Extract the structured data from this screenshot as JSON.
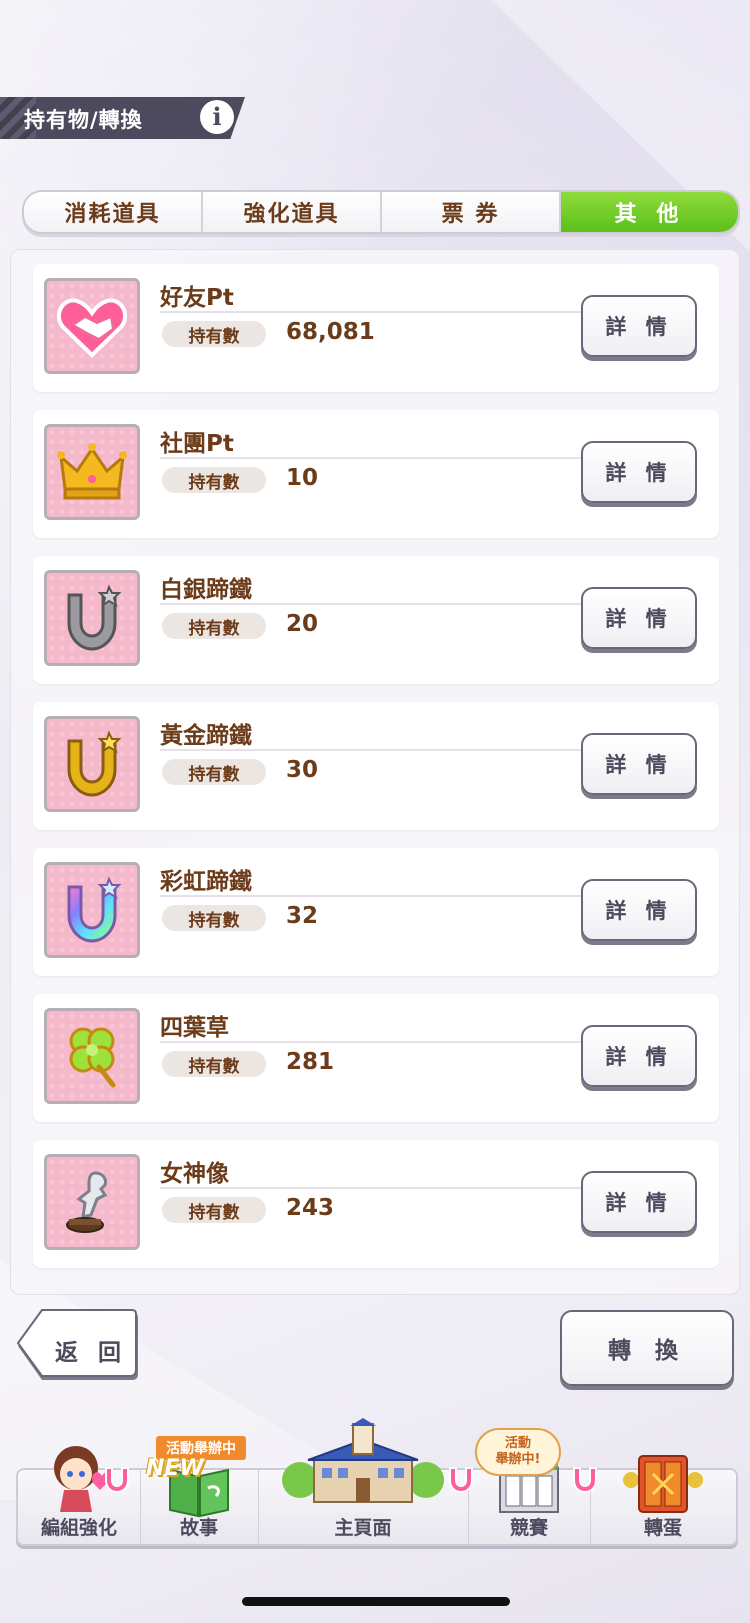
{
  "header": {
    "title": "持有物/轉換",
    "info_label": "i"
  },
  "tabs": [
    {
      "label": "消耗道具",
      "active": false
    },
    {
      "label": "強化道具",
      "active": false
    },
    {
      "label": "票 券",
      "active": false
    },
    {
      "label": "其 他",
      "active": true
    }
  ],
  "items": [
    {
      "name": "好友Pt",
      "hold_label": "持有數",
      "value": "68,081",
      "detail": "詳 情",
      "icon": "handshake-heart-icon"
    },
    {
      "name": "社團Pt",
      "hold_label": "持有數",
      "value": "10",
      "detail": "詳 情",
      "icon": "crown-icon"
    },
    {
      "name": "白銀蹄鐵",
      "hold_label": "持有數",
      "value": "20",
      "detail": "詳 情",
      "icon": "silver-horseshoe-icon"
    },
    {
      "name": "黃金蹄鐵",
      "hold_label": "持有數",
      "value": "30",
      "detail": "詳 情",
      "icon": "gold-horseshoe-icon"
    },
    {
      "name": "彩虹蹄鐵",
      "hold_label": "持有數",
      "value": "32",
      "detail": "詳 情",
      "icon": "rainbow-horseshoe-icon"
    },
    {
      "name": "四葉草",
      "hold_label": "持有數",
      "value": "281",
      "detail": "詳 情",
      "icon": "four-leaf-clover-icon"
    },
    {
      "name": "女神像",
      "hold_label": "持有數",
      "value": "243",
      "detail": "詳 情",
      "icon": "goddess-statue-icon"
    }
  ],
  "actions": {
    "back": "返 回",
    "convert": "轉 換"
  },
  "nav": {
    "items": [
      {
        "label": "編組強化",
        "icon": "character-icon"
      },
      {
        "label": "故事",
        "icon": "book-icon"
      },
      {
        "label": "主頁面",
        "icon": "school-building-icon"
      },
      {
        "label": "競賽",
        "icon": "race-gate-icon"
      },
      {
        "label": "轉蛋",
        "icon": "gacha-gate-icon"
      }
    ],
    "story_badge": "活動舉辦中",
    "story_new": "NEW",
    "race_bubble_line1": "活動",
    "race_bubble_line2": "舉辦中!"
  },
  "colors": {
    "accent_green": "#6cc72a",
    "text_brown": "#6b3b1a",
    "button_border": "#6a6878"
  }
}
